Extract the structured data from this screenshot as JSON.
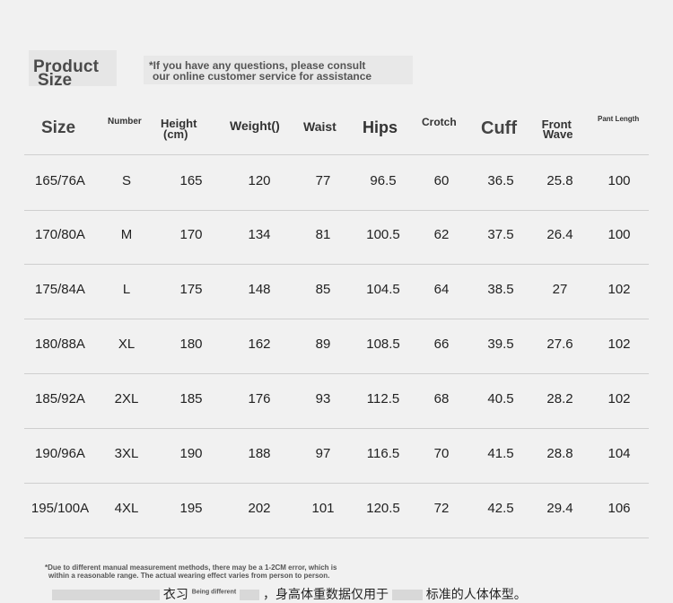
{
  "title": {
    "line1": "Product",
    "line2": "Size"
  },
  "note": {
    "line1": "*If you have any questions, please consult",
    "line2": "our online customer service for assistance"
  },
  "headers": {
    "size": "Size",
    "number": "Number",
    "height_line1": "Height",
    "height_line2": "(cm)",
    "weight": "Weight()",
    "waist": "Waist",
    "hips": "Hips",
    "crotch": "Crotch",
    "cuff": "Cuff",
    "front_line1": "Front",
    "front_line2": "Wave",
    "pant_length": "Pant Length"
  },
  "rows": [
    [
      "165/76A",
      "S",
      "165",
      "120",
      "77",
      "96.5",
      "60",
      "36.5",
      "25.8",
      "100"
    ],
    [
      "170/80A",
      "M",
      "170",
      "134",
      "81",
      "100.5",
      "62",
      "37.5",
      "26.4",
      "100"
    ],
    [
      "175/84A",
      "L",
      "175",
      "148",
      "85",
      "104.5",
      "64",
      "38.5",
      "27",
      "102"
    ],
    [
      "180/88A",
      "XL",
      "180",
      "162",
      "89",
      "108.5",
      "66",
      "39.5",
      "27.6",
      "102"
    ],
    [
      "185/92A",
      "2XL",
      "185",
      "176",
      "93",
      "112.5",
      "68",
      "40.5",
      "28.2",
      "102"
    ],
    [
      "190/96A",
      "3XL",
      "190",
      "188",
      "97",
      "116.5",
      "70",
      "41.5",
      "28.8",
      "104"
    ],
    [
      "195/100A",
      "4XL",
      "195",
      "202",
      "101",
      "120.5",
      "72",
      "42.5",
      "29.4",
      "106"
    ]
  ],
  "footnote": {
    "line1": "*Due to different manual measurement methods, there may be a 1-2CM error, which is",
    "line2": "within a reasonable range. The actual wearing effect varies from person to person.",
    "cn_a": "衣习",
    "cn_b": "，身高体重数据仅",
    "cn_c": "用于",
    "cn_d": "标准的人体体型。",
    "being_different": "Being different"
  }
}
